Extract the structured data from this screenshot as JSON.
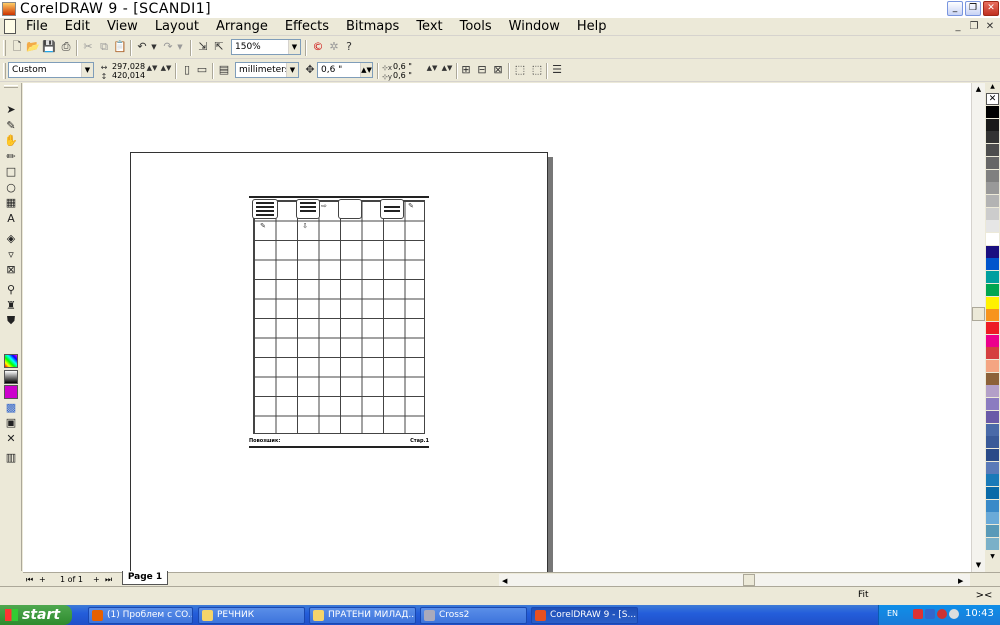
{
  "window": {
    "title": "CorelDRAW 9 - [SCANDI1]"
  },
  "menu": [
    "File",
    "Edit",
    "View",
    "Layout",
    "Arrange",
    "Effects",
    "Bitmaps",
    "Text",
    "Tools",
    "Window",
    "Help"
  ],
  "toolbar": {
    "zoom": "150%"
  },
  "propertybar": {
    "paper_size": "Custom",
    "width": "297,028",
    "height": "420,014",
    "units": "millimeters",
    "nudge": "0,6 \"",
    "dup_x": "0,6 \"",
    "dup_y": "0,6 \""
  },
  "document": {
    "footer_left": "Повозшик:",
    "footer_right": "Стар.1"
  },
  "page_nav": {
    "counter": "1 of 1",
    "tab": "Page 1"
  },
  "status": {
    "zoom_mode": "Fit"
  },
  "taskbar": {
    "start": "start",
    "items": [
      {
        "label": "(1) Проблем с CO..."
      },
      {
        "label": "РЕЧНИК"
      },
      {
        "label": "ПРАТЕНИ МИЛАД..."
      },
      {
        "label": "Cross2"
      },
      {
        "label": "CorelDRAW 9 - [S..."
      }
    ],
    "tray_lang": "EN",
    "clock": "10:43"
  },
  "palette_colors": [
    "#000000",
    "#1a1a1a",
    "#333333",
    "#4d4d4d",
    "#666666",
    "#808080",
    "#999999",
    "#b3b3b3",
    "#cccccc",
    "#e6e6e6",
    "#ffffff",
    "#1a0f80",
    "#0055cc",
    "#009f9f",
    "#00a651",
    "#fff200",
    "#f7941d",
    "#ed1c24",
    "#ec008c",
    "#d53f3f",
    "#f4a582",
    "#8c6239",
    "#b3a0c8",
    "#8b7cc0",
    "#6a5aa8",
    "#4a6aa8",
    "#3a5a98",
    "#2a4a88",
    "#5a7ab8",
    "#1a7ab8",
    "#0a6aa8",
    "#3a8ac8",
    "#6aaad8",
    "#5a9ab8",
    "#7ab0c8"
  ]
}
